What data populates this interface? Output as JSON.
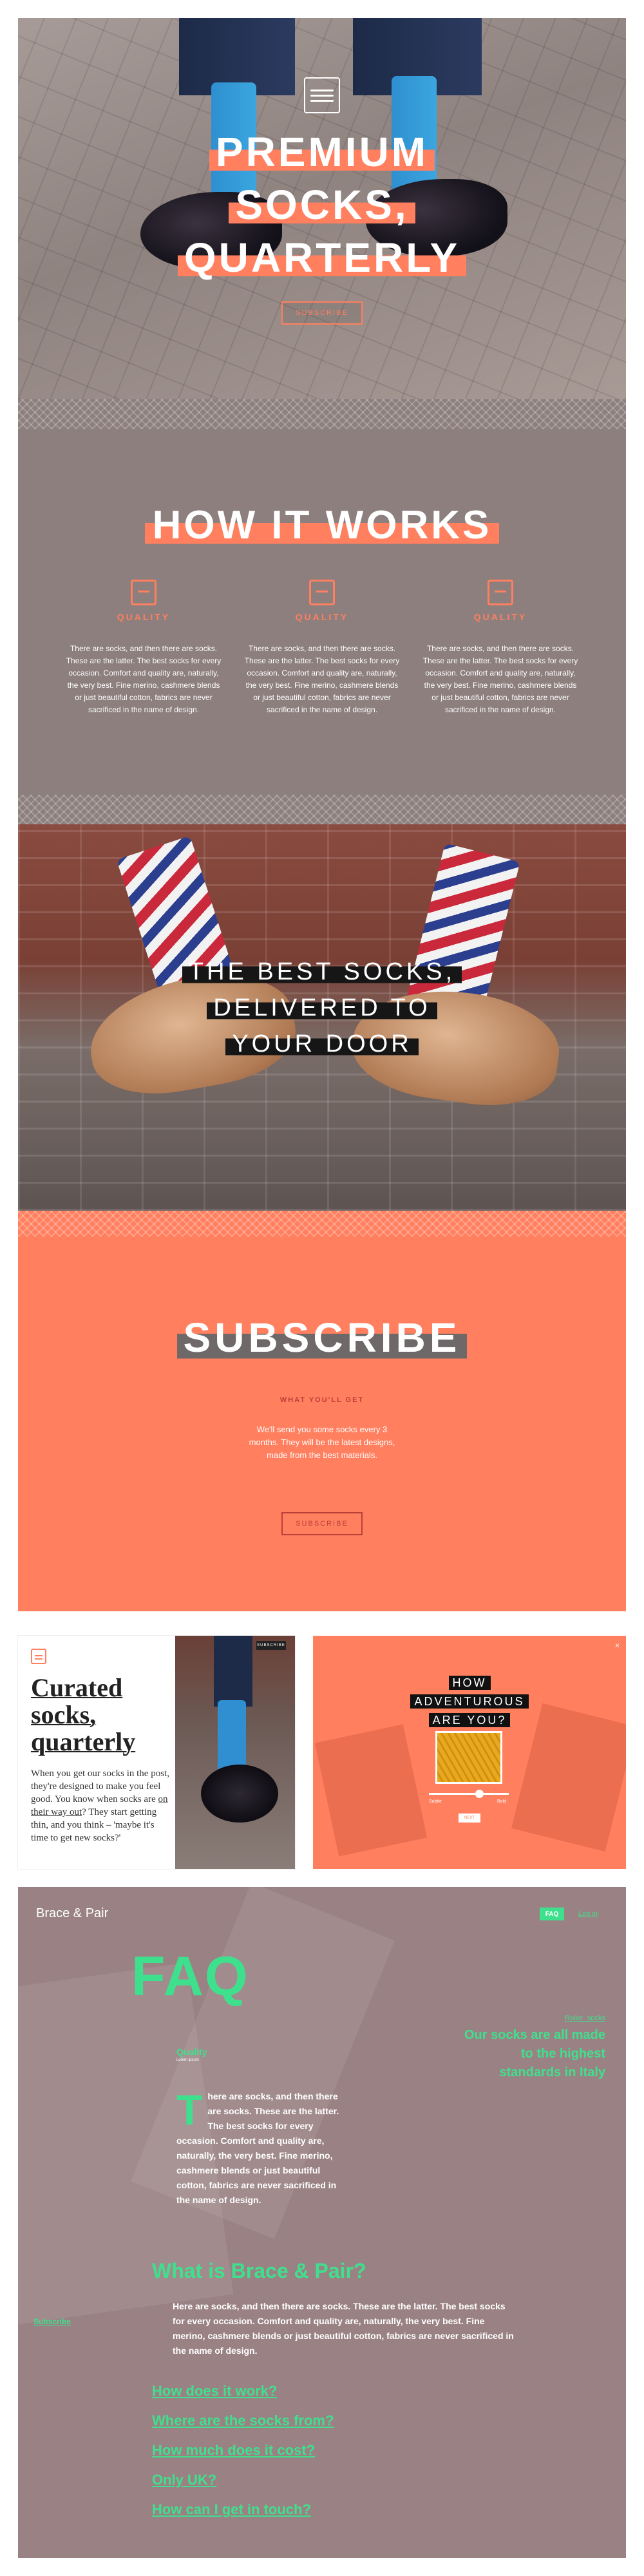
{
  "hero": {
    "title_lines": [
      "PREMIUM",
      "SOCKS,",
      "QUARTERLY"
    ],
    "button_label": "SUBSCRIBE"
  },
  "how": {
    "title": "HOW IT WORKS",
    "columns": [
      {
        "icon": "box-icon",
        "label": "QUALITY",
        "text": "There are socks, and then there are socks. These are the latter. The best socks for every occasion. Comfort and quality are, naturally, the very best. Fine merino, cashmere blends or just beautiful cotton, fabrics are never sacrificed in the name of design."
      },
      {
        "icon": "tools-icon",
        "label": "QUALITY",
        "text": "There are socks, and then there are socks. These are the latter. The best socks for every occasion. Comfort and quality are, naturally, the very best. Fine merino, cashmere blends or just beautiful cotton, fabrics are never sacrificed in the name of design."
      },
      {
        "icon": "calendar-icon",
        "label": "QUALITY",
        "text": "There are socks, and then there are socks. These are the latter. The best socks for every occasion. Comfort and quality are, naturally, the very best. Fine merino, cashmere blends or just beautiful cotton, fabrics are never sacrificed in the name of design."
      }
    ]
  },
  "delivery": {
    "lines": [
      "THE BEST SOCKS,",
      "DELIVERED TO",
      "YOUR DOOR"
    ]
  },
  "subscribe": {
    "title": "SUBSCRIBE",
    "kicker": "WHAT YOU'LL GET",
    "text": "We'll send you some socks every 3 months. They will be the latest designs, made from the best materials.",
    "button_label": "SUBSCRIBE"
  },
  "card_curated": {
    "title_lines": [
      "Curated",
      "socks,",
      "quarterly"
    ],
    "body_before": "When you get our socks in the post, they're designed to make you feel good. You know when socks are ",
    "body_link": "on their way out",
    "body_after": "? They start getting thin, and you think – 'maybe it's time to get new socks?'",
    "pill": "SUBSCRIBE"
  },
  "card_quiz": {
    "lines": [
      "HOW",
      "ADVENTUROUS",
      "ARE YOU?"
    ],
    "scale_low": "Subtle",
    "scale_high": "Bold",
    "button_label": "NEXT",
    "close": "×"
  },
  "faq": {
    "brand": "Brace & Pair",
    "nav_tab": "FAQ",
    "login": "Log in",
    "title": "FAQ",
    "quality_heading": "Quality",
    "quality_sub": "Lorem ipsum",
    "drop_cap": "T",
    "body": "here are socks, and then there are socks. These are the latter. The best socks for every occasion. Comfort and quality are, naturally, the very best. Fine merino, cashmere blends or just beautiful cotton, fabrics are never sacrificed in the name of design.",
    "side_link": "Roller_socks",
    "side_text": "Our socks are all made to the highest standards in Italy",
    "question": "What is Brace & Pair?",
    "answer": "Here are socks, and then there are socks. These are the latter. The best socks for every occasion. Comfort and quality are, naturally, the very best. Fine merino, cashmere blends or just beautiful cotton, fabrics are never sacrificed in the name of design.",
    "subscribe_link": "Subscribe",
    "questions": [
      "How does it work?",
      "Where are the socks from?",
      "How much does it cost?",
      "Only UK?",
      "How can I get in touch?"
    ]
  },
  "colors": {
    "accent": "#ff7f5f",
    "green": "#3fe08d",
    "mauve": "#9a8284",
    "grey": "#8c7f7e"
  }
}
